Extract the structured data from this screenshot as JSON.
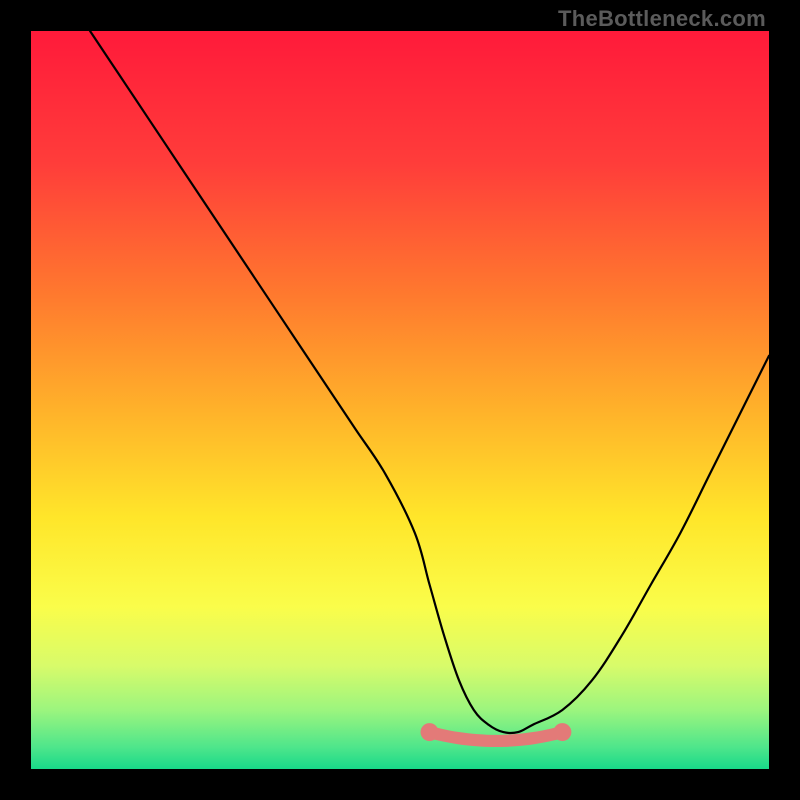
{
  "watermark": "TheBottleneck.com",
  "chart_data": {
    "type": "line",
    "title": "",
    "xlabel": "",
    "ylabel": "",
    "xlim": [
      0,
      100
    ],
    "ylim": [
      0,
      100
    ],
    "grid": false,
    "legend": false,
    "series": [
      {
        "name": "bottleneck-curve",
        "color": "#000000",
        "x": [
          8,
          12,
          16,
          20,
          24,
          28,
          32,
          36,
          40,
          44,
          48,
          52,
          54,
          56,
          58,
          60,
          62,
          64,
          66,
          68,
          72,
          76,
          80,
          84,
          88,
          92,
          96,
          100
        ],
        "y": [
          100,
          94,
          88,
          82,
          76,
          70,
          64,
          58,
          52,
          46,
          40,
          32,
          25,
          18,
          12,
          8,
          6,
          5,
          5,
          6,
          8,
          12,
          18,
          25,
          32,
          40,
          48,
          56
        ]
      }
    ],
    "highlight_band": {
      "name": "optimal-range",
      "color": "#e37a78",
      "x_start": 54,
      "x_end": 72,
      "y": 5,
      "thickness": 3
    },
    "background_gradient": {
      "stops": [
        {
          "offset": 0.0,
          "color": "#ff1a3a"
        },
        {
          "offset": 0.18,
          "color": "#ff3d3a"
        },
        {
          "offset": 0.36,
          "color": "#ff7a2e"
        },
        {
          "offset": 0.52,
          "color": "#ffb42a"
        },
        {
          "offset": 0.66,
          "color": "#ffe62a"
        },
        {
          "offset": 0.78,
          "color": "#fafd4a"
        },
        {
          "offset": 0.86,
          "color": "#d8fb6a"
        },
        {
          "offset": 0.92,
          "color": "#9cf57e"
        },
        {
          "offset": 0.97,
          "color": "#4fe68b"
        },
        {
          "offset": 1.0,
          "color": "#18d989"
        }
      ]
    }
  }
}
